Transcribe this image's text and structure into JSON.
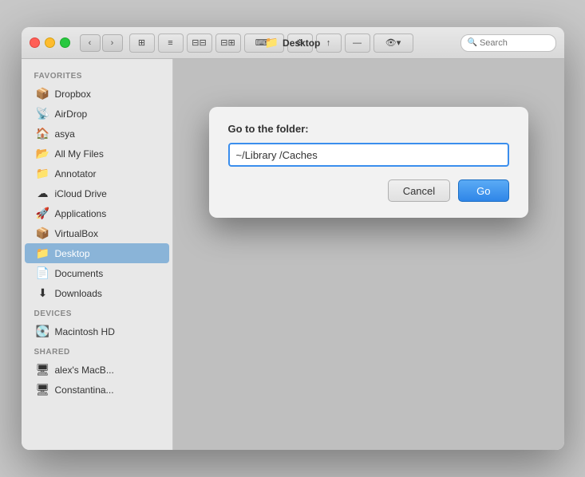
{
  "window": {
    "title": "Desktop",
    "traffic_lights": [
      "close",
      "minimize",
      "maximize"
    ]
  },
  "toolbar": {
    "back_label": "‹",
    "forward_label": "›",
    "view_icons": [
      "⊞",
      "≡",
      "⊟",
      "⊞⊟",
      "⌨",
      "⚙",
      "↑",
      "—",
      "👁"
    ],
    "search_placeholder": "Search",
    "search_value": ""
  },
  "sidebar": {
    "favorites_label": "Favorites",
    "items": [
      {
        "id": "dropbox",
        "label": "Dropbox",
        "icon": "📦"
      },
      {
        "id": "airdrop",
        "label": "AirDrop",
        "icon": "📡"
      },
      {
        "id": "asya",
        "label": "asya",
        "icon": "🏠"
      },
      {
        "id": "all-my-files",
        "label": "All My Files",
        "icon": "📂"
      },
      {
        "id": "annotator",
        "label": "Annotator",
        "icon": "📁"
      },
      {
        "id": "icloud-drive",
        "label": "iCloud Drive",
        "icon": "☁"
      },
      {
        "id": "applications",
        "label": "Applications",
        "icon": "🚀"
      },
      {
        "id": "virtualbox",
        "label": "VirtualBox",
        "icon": "📦"
      },
      {
        "id": "desktop",
        "label": "Desktop",
        "icon": "📁",
        "active": true
      },
      {
        "id": "documents",
        "label": "Documents",
        "icon": "📄"
      },
      {
        "id": "downloads",
        "label": "Downloads",
        "icon": "⬇"
      }
    ],
    "devices_label": "Devices",
    "devices": [
      {
        "id": "macintosh-hd",
        "label": "Macintosh HD",
        "icon": "💽"
      }
    ],
    "shared_label": "Shared",
    "shared": [
      {
        "id": "alexs-macb",
        "label": "alex's MacB...",
        "icon": "🖥"
      },
      {
        "id": "constantina",
        "label": "Constantina...",
        "icon": "🖥"
      }
    ]
  },
  "dialog": {
    "title": "Go to the folder:",
    "input_value": "~/Library /Caches",
    "cancel_label": "Cancel",
    "go_label": "Go"
  }
}
